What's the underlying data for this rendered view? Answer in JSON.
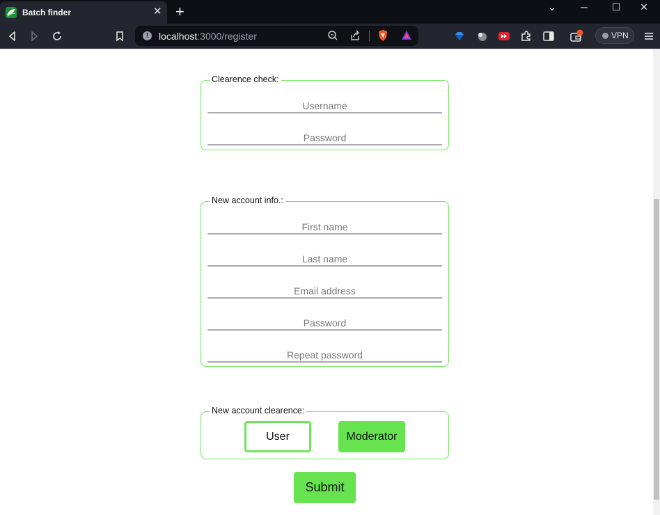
{
  "browser": {
    "tab_title": "Batch finder",
    "tab_close": "✕",
    "new_tab": "+",
    "url_host": "localhost",
    "url_path": ":3000/register",
    "vpn_label": "VPN",
    "window": {
      "minimize": "─",
      "maximize": "☐",
      "close": "✕",
      "dropdown": "⌄"
    }
  },
  "clearance_check": {
    "legend": "Clearence check:",
    "fields": [
      {
        "placeholder": "Username"
      },
      {
        "placeholder": "Password"
      }
    ]
  },
  "new_account_info": {
    "legend": "New account info.:",
    "fields": [
      {
        "placeholder": "First name"
      },
      {
        "placeholder": "Last name"
      },
      {
        "placeholder": "Email address"
      },
      {
        "placeholder": "Password"
      },
      {
        "placeholder": "Repeat password"
      }
    ]
  },
  "new_account_clearance": {
    "legend": "New account clearence:",
    "options": [
      "User",
      "Moderator"
    ]
  },
  "submit_label": "Submit",
  "colors": {
    "accent": "#66e34f",
    "border": "#6ee55a",
    "chrome_bg": "#23262f",
    "title_bg": "#0d0f14"
  }
}
